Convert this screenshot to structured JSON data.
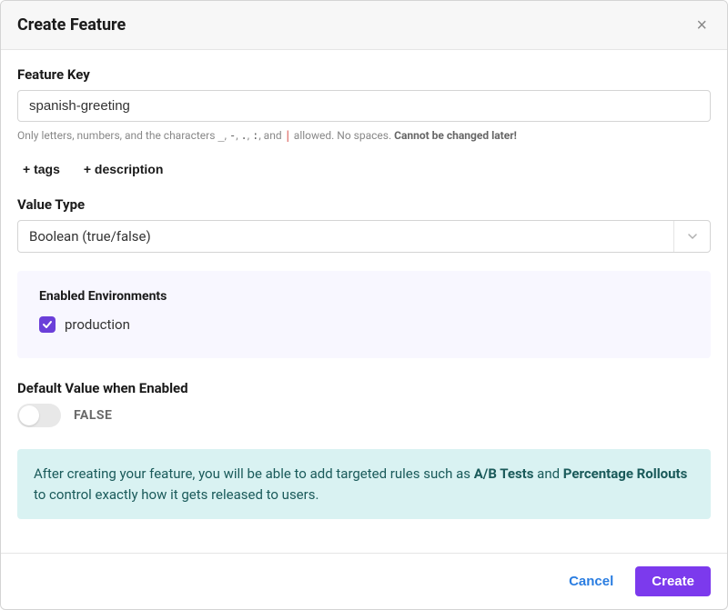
{
  "modal": {
    "title": "Create Feature",
    "close_label": "×"
  },
  "feature_key": {
    "label": "Feature Key",
    "value": "spanish-greeting",
    "helper_prefix": "Only letters, numbers, and the characters ",
    "helper_chars_1": "_",
    "helper_chars_2": "-",
    "helper_chars_3": ".",
    "helper_chars_4": ":",
    "helper_and": ", and ",
    "helper_pipe": "|",
    "helper_suffix_1": " allowed. No spaces. ",
    "helper_bold": "Cannot be changed later!"
  },
  "chips": {
    "tags": "+ tags",
    "description": "+ description"
  },
  "value_type": {
    "label": "Value Type",
    "selected": "Boolean (true/false)"
  },
  "environments": {
    "title": "Enabled Environments",
    "items": [
      {
        "name": "production",
        "checked": true
      }
    ]
  },
  "default_value": {
    "label": "Default Value when Enabled",
    "toggle_on": false,
    "toggle_text": "FALSE"
  },
  "info": {
    "text_1": "After creating your feature, you will be able to add targeted rules such as ",
    "bold_1": "A/B Tests",
    "text_2": " and ",
    "bold_2": "Percentage Rollouts",
    "text_3": " to control exactly how it gets released to users."
  },
  "footer": {
    "cancel": "Cancel",
    "create": "Create"
  }
}
